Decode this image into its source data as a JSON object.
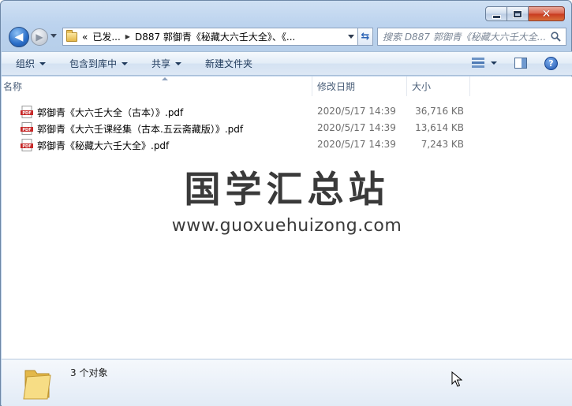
{
  "window": {
    "caption_buttons": {
      "minimize": "minimize",
      "maximize": "maximize",
      "close": "✕"
    }
  },
  "nav": {
    "address_segments": [
      "«",
      "已发...",
      "D887 郭御青《秘藏大六壬大全》、《..."
    ],
    "search_placeholder": "搜索 D887 郭御青《秘藏大六壬大全...",
    "icons": {
      "back": "back-arrow-icon",
      "forward": "forward-arrow-icon",
      "refresh": "refresh-icon",
      "search": "magnifier-icon"
    }
  },
  "toolbar": {
    "organize": "组织",
    "include_in_library": "包含到库中",
    "share": "共享",
    "new_folder": "新建文件夹"
  },
  "columns": {
    "name": "名称",
    "date": "修改日期",
    "size": "大小"
  },
  "files": [
    {
      "name": "郭御青《大六壬大全（古本）》.pdf",
      "date": "2020/5/17 14:39",
      "size": "36,716 KB"
    },
    {
      "name": "郭御青《大六壬课经集（古本.五云斋藏版）》.pdf",
      "date": "2020/5/17 14:39",
      "size": "13,614 KB"
    },
    {
      "name": "郭御青《秘藏大六壬大全》.pdf",
      "date": "2020/5/17 14:39",
      "size": "7,243 KB"
    }
  ],
  "watermark": {
    "title": "国学汇总站",
    "url": "www.guoxuehuizong.com"
  },
  "status": {
    "item_count": "3 个对象"
  },
  "colors": {
    "accent": "#2a6ec8",
    "pdf_red": "#c62828",
    "folder": "#e8c15c"
  }
}
